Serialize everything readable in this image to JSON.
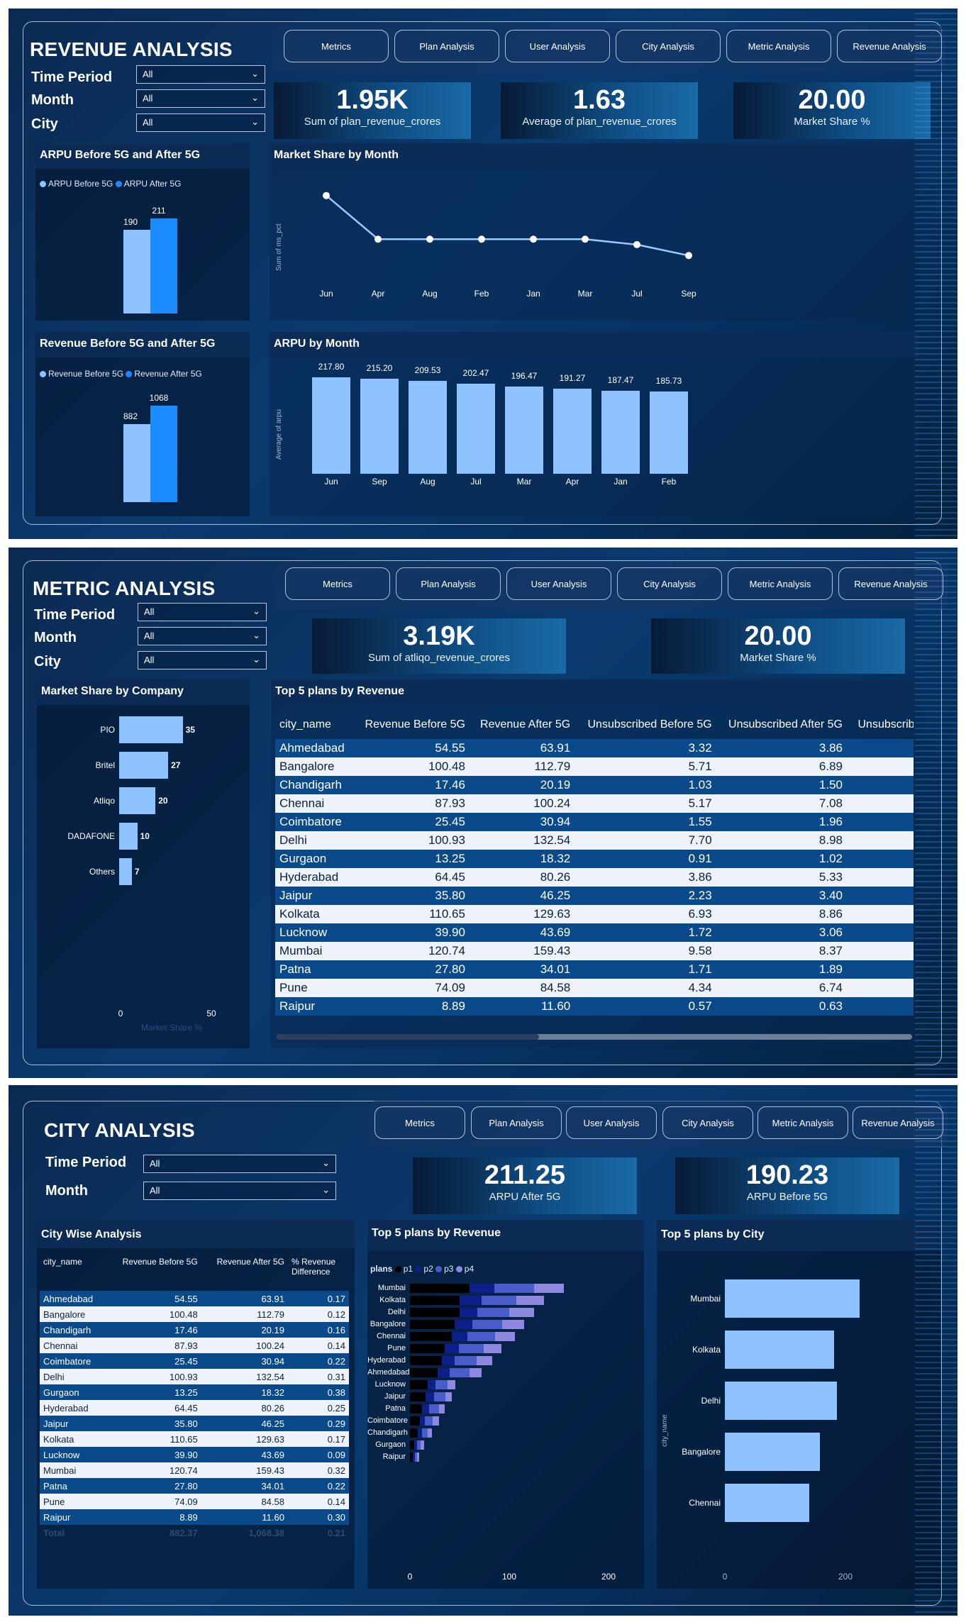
{
  "nav": [
    "Metrics",
    "Plan Analysis",
    "User Analysis",
    "City Analysis",
    "Metric Analysis",
    "Revenue Analysis"
  ],
  "filters": {
    "time_period": "Time Period",
    "month": "Month",
    "city": "City",
    "all": "All"
  },
  "revenue": {
    "title": "REVENUE ANALYSIS",
    "kpis": [
      {
        "value": "1.95K",
        "label": "Sum of plan_revenue_crores"
      },
      {
        "value": "1.63",
        "label": "Average of plan_revenue_crores"
      },
      {
        "value": "20.00",
        "label": "Market Share %"
      }
    ],
    "arpu_card": {
      "title": "ARPU Before 5G and  After 5G",
      "legend": [
        "ARPU Before 5G",
        "ARPU After 5G"
      ],
      "values": [
        190,
        211
      ],
      "labels": [
        "190",
        "211"
      ]
    },
    "rev_card": {
      "title": "Revenue Before 5G and After 5G",
      "legend": [
        "Revenue Before 5G",
        "Revenue After 5G"
      ],
      "values": [
        882,
        1068
      ],
      "labels": [
        "882",
        "1068"
      ]
    },
    "ms_month": {
      "title": "Market Share by Month",
      "ylabel": "Sum of ms_pct"
    },
    "arpu_month": {
      "title": "ARPU by Month",
      "ylabel": "Average of arpu"
    }
  },
  "metric": {
    "title": "METRIC ANALYSIS",
    "kpis": [
      {
        "value": "3.19K",
        "label": "Sum of atliqo_revenue_crores"
      },
      {
        "value": "20.00",
        "label": "Market Share %"
      }
    ],
    "company_card": {
      "title": "Market Share by Company",
      "xlabel": "Market Share %",
      "ticks": [
        "0",
        "50"
      ]
    },
    "table_card": {
      "title": "Top 5 plans by Revenue",
      "headers": [
        "city_name",
        "Revenue Before 5G",
        "Revenue After 5G",
        "Unsubscribed Before 5G",
        "Unsubscribed After 5G",
        "Unsubscribed % C"
      ]
    },
    "rows": [
      [
        "Ahmedabad",
        "54.55",
        "63.91",
        "3.32",
        "3.86"
      ],
      [
        "Bangalore",
        "100.48",
        "112.79",
        "5.71",
        "6.89"
      ],
      [
        "Chandigarh",
        "17.46",
        "20.19",
        "1.03",
        "1.50"
      ],
      [
        "Chennai",
        "87.93",
        "100.24",
        "5.17",
        "7.08"
      ],
      [
        "Coimbatore",
        "25.45",
        "30.94",
        "1.55",
        "1.96"
      ],
      [
        "Delhi",
        "100.93",
        "132.54",
        "7.70",
        "8.98"
      ],
      [
        "Gurgaon",
        "13.25",
        "18.32",
        "0.91",
        "1.02"
      ],
      [
        "Hyderabad",
        "64.45",
        "80.26",
        "3.86",
        "5.33"
      ],
      [
        "Jaipur",
        "35.80",
        "46.25",
        "2.23",
        "3.40"
      ],
      [
        "Kolkata",
        "110.65",
        "129.63",
        "6.93",
        "8.86"
      ],
      [
        "Lucknow",
        "39.90",
        "43.69",
        "1.72",
        "3.06"
      ],
      [
        "Mumbai",
        "120.74",
        "159.43",
        "9.58",
        "8.37"
      ],
      [
        "Patna",
        "27.80",
        "34.01",
        "1.71",
        "1.89"
      ],
      [
        "Pune",
        "74.09",
        "84.58",
        "4.34",
        "6.74"
      ],
      [
        "Raipur",
        "8.89",
        "11.60",
        "0.57",
        "0.63"
      ]
    ]
  },
  "city": {
    "title": "CITY ANALYSIS",
    "kpis": [
      {
        "value": "211.25",
        "label": "ARPU After 5G"
      },
      {
        "value": "190.23",
        "label": "ARPU Before 5G"
      }
    ],
    "table_card": {
      "title": "City Wise Analysis",
      "headers": [
        "city_name",
        "Revenue Before 5G",
        "Revenue After 5G",
        "% Revenue Difference"
      ],
      "total": [
        "Total",
        "882.37",
        "1,068.38",
        "0.21"
      ]
    },
    "rows": [
      [
        "Ahmedabad",
        "54.55",
        "63.91",
        "0.17"
      ],
      [
        "Bangalore",
        "100.48",
        "112.79",
        "0.12"
      ],
      [
        "Chandigarh",
        "17.46",
        "20.19",
        "0.16"
      ],
      [
        "Chennai",
        "87.93",
        "100.24",
        "0.14"
      ],
      [
        "Coimbatore",
        "25.45",
        "30.94",
        "0.22"
      ],
      [
        "Delhi",
        "100.93",
        "132.54",
        "0.31"
      ],
      [
        "Gurgaon",
        "13.25",
        "18.32",
        "0.38"
      ],
      [
        "Hyderabad",
        "64.45",
        "80.26",
        "0.25"
      ],
      [
        "Jaipur",
        "35.80",
        "46.25",
        "0.29"
      ],
      [
        "Kolkata",
        "110.65",
        "129.63",
        "0.17"
      ],
      [
        "Lucknow",
        "39.90",
        "43.69",
        "0.09"
      ],
      [
        "Mumbai",
        "120.74",
        "159.43",
        "0.32"
      ],
      [
        "Patna",
        "27.80",
        "34.01",
        "0.22"
      ],
      [
        "Pune",
        "74.09",
        "84.58",
        "0.14"
      ],
      [
        "Raipur",
        "8.89",
        "11.60",
        "0.30"
      ]
    ],
    "stack_card": {
      "title": "Top 5 plans by Revenue",
      "legend_title": "plans",
      "legend": [
        "p1",
        "p2",
        "p3",
        "p4"
      ]
    },
    "city_card": {
      "title": "Top 5 plans by City",
      "ylabel": "city_name"
    }
  },
  "chart_data": [
    {
      "type": "line",
      "title": "Market Share by Month",
      "ylabel": "Sum of ms_pct",
      "categories": [
        "Jun",
        "Apr",
        "Aug",
        "Feb",
        "Jan",
        "Mar",
        "Jul",
        "Sep"
      ],
      "values": [
        2.4,
        2.0,
        2.0,
        2.0,
        2.0,
        2.0,
        1.95,
        1.85
      ]
    },
    {
      "type": "bar",
      "title": "ARPU by Month",
      "ylabel": "Average of arpu",
      "categories": [
        "Jun",
        "Sep",
        "Aug",
        "Jul",
        "Mar",
        "Apr",
        "Jan",
        "Feb"
      ],
      "values": [
        217.8,
        215.2,
        209.53,
        202.47,
        196.47,
        191.27,
        187.47,
        185.73
      ],
      "labels": [
        "217.80",
        "215.20",
        "209.53",
        "202.47",
        "196.47",
        "191.27",
        "187.47",
        "185.73"
      ],
      "ylim": [
        0,
        240
      ]
    },
    {
      "type": "bar",
      "title": "Market Share by Company",
      "xlabel": "Market Share %",
      "categories": [
        "PIO",
        "Britel",
        "Atliqo",
        "DADAFONE",
        "Others"
      ],
      "values": [
        35,
        27,
        20,
        10,
        7
      ],
      "xlim": [
        0,
        50
      ]
    },
    {
      "type": "bar",
      "title": "Top 5 plans by Revenue",
      "categories": [
        "Mumbai",
        "Kolkata",
        "Delhi",
        "Bangalore",
        "Chennai",
        "Pune",
        "Hyderabad",
        "Ahmedabad",
        "Lucknow",
        "Jaipur",
        "Patna",
        "Coimbatore",
        "Chandigarh",
        "Gurgaon",
        "Raipur"
      ],
      "series": [
        {
          "name": "p1",
          "values": [
            60,
            50,
            50,
            45,
            42,
            35,
            32,
            28,
            18,
            16,
            12,
            10,
            8,
            4,
            3
          ]
        },
        {
          "name": "p2",
          "values": [
            25,
            22,
            18,
            18,
            16,
            14,
            13,
            12,
            8,
            8,
            7,
            5,
            4,
            3,
            2
          ]
        },
        {
          "name": "p3",
          "values": [
            40,
            35,
            32,
            30,
            28,
            25,
            22,
            20,
            12,
            12,
            10,
            8,
            6,
            4,
            2
          ]
        },
        {
          "name": "p4",
          "values": [
            30,
            28,
            25,
            22,
            20,
            18,
            16,
            12,
            8,
            6,
            6,
            6,
            4,
            3,
            2
          ]
        }
      ],
      "xlim": [
        0,
        200
      ],
      "ticks": [
        "0",
        "100",
        "200"
      ]
    },
    {
      "type": "bar",
      "title": "Top 5 plans by City",
      "ylabel": "city_name",
      "categories": [
        "Mumbai",
        "Kolkata",
        "Delhi",
        "Bangalore",
        "Chennai"
      ],
      "values": [
        159.43,
        129.63,
        132.54,
        112.79,
        100.24
      ],
      "xlim": [
        0,
        200
      ],
      "ticks": [
        "0",
        "200"
      ]
    }
  ]
}
